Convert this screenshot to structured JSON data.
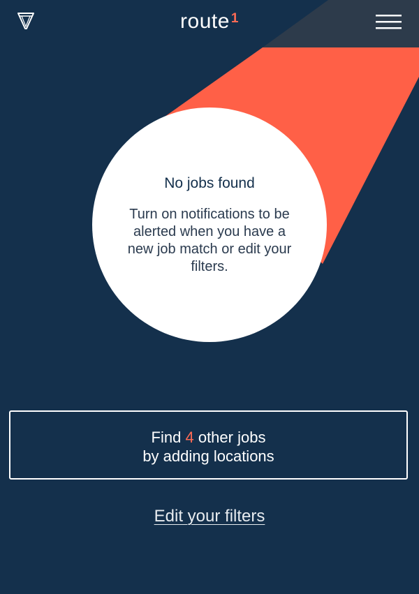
{
  "header": {
    "logo_text": "route",
    "logo_superscript": "1",
    "filter_icon": "filter-funnel-icon",
    "menu_icon": "hamburger-menu-icon"
  },
  "empty_state": {
    "title": "No jobs found",
    "message": "Turn on notifications to be alerted when you have a new job match or edit your filters."
  },
  "find_button": {
    "prefix": "Find",
    "count": "4",
    "suffix": "other jobs",
    "line2": "by adding locations"
  },
  "edit_filters_link": "Edit your filters",
  "colors": {
    "background": "#14304c",
    "accent": "#ff6b55",
    "header_band": "#2d3b4b",
    "circle": "#ffffff"
  }
}
